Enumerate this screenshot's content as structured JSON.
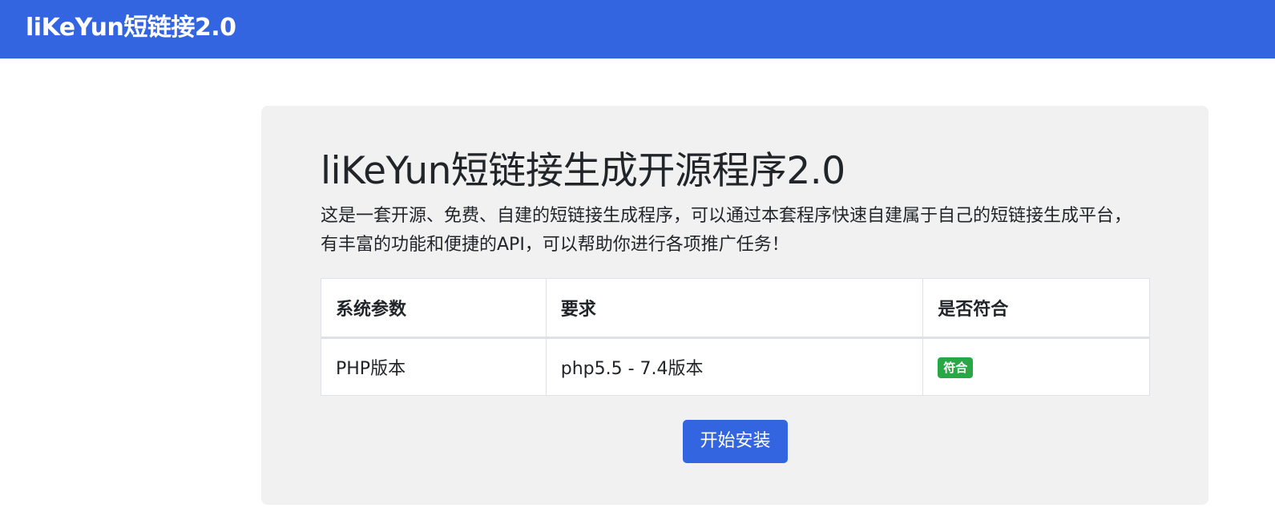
{
  "navbar": {
    "brand": "liKeYun短链接2.0"
  },
  "jumbotron": {
    "title": "liKeYun短链接生成开源程序2.0",
    "lead": "这是一套开源、免费、自建的短链接生成程序，可以通过本套程序快速自建属于自己的短链接生成平台，有丰富的功能和便捷的API，可以帮助你进行各项推广任务！"
  },
  "table": {
    "headers": [
      "系统参数",
      "要求",
      "是否符合"
    ],
    "rows": [
      {
        "param": "PHP版本",
        "requirement": "php5.5 - 7.4版本",
        "status": "符合"
      }
    ]
  },
  "install_button": {
    "label": "开始安装"
  },
  "colors": {
    "brand": "#3465e0",
    "success": "#28a745",
    "panel": "#f1f1f1"
  }
}
